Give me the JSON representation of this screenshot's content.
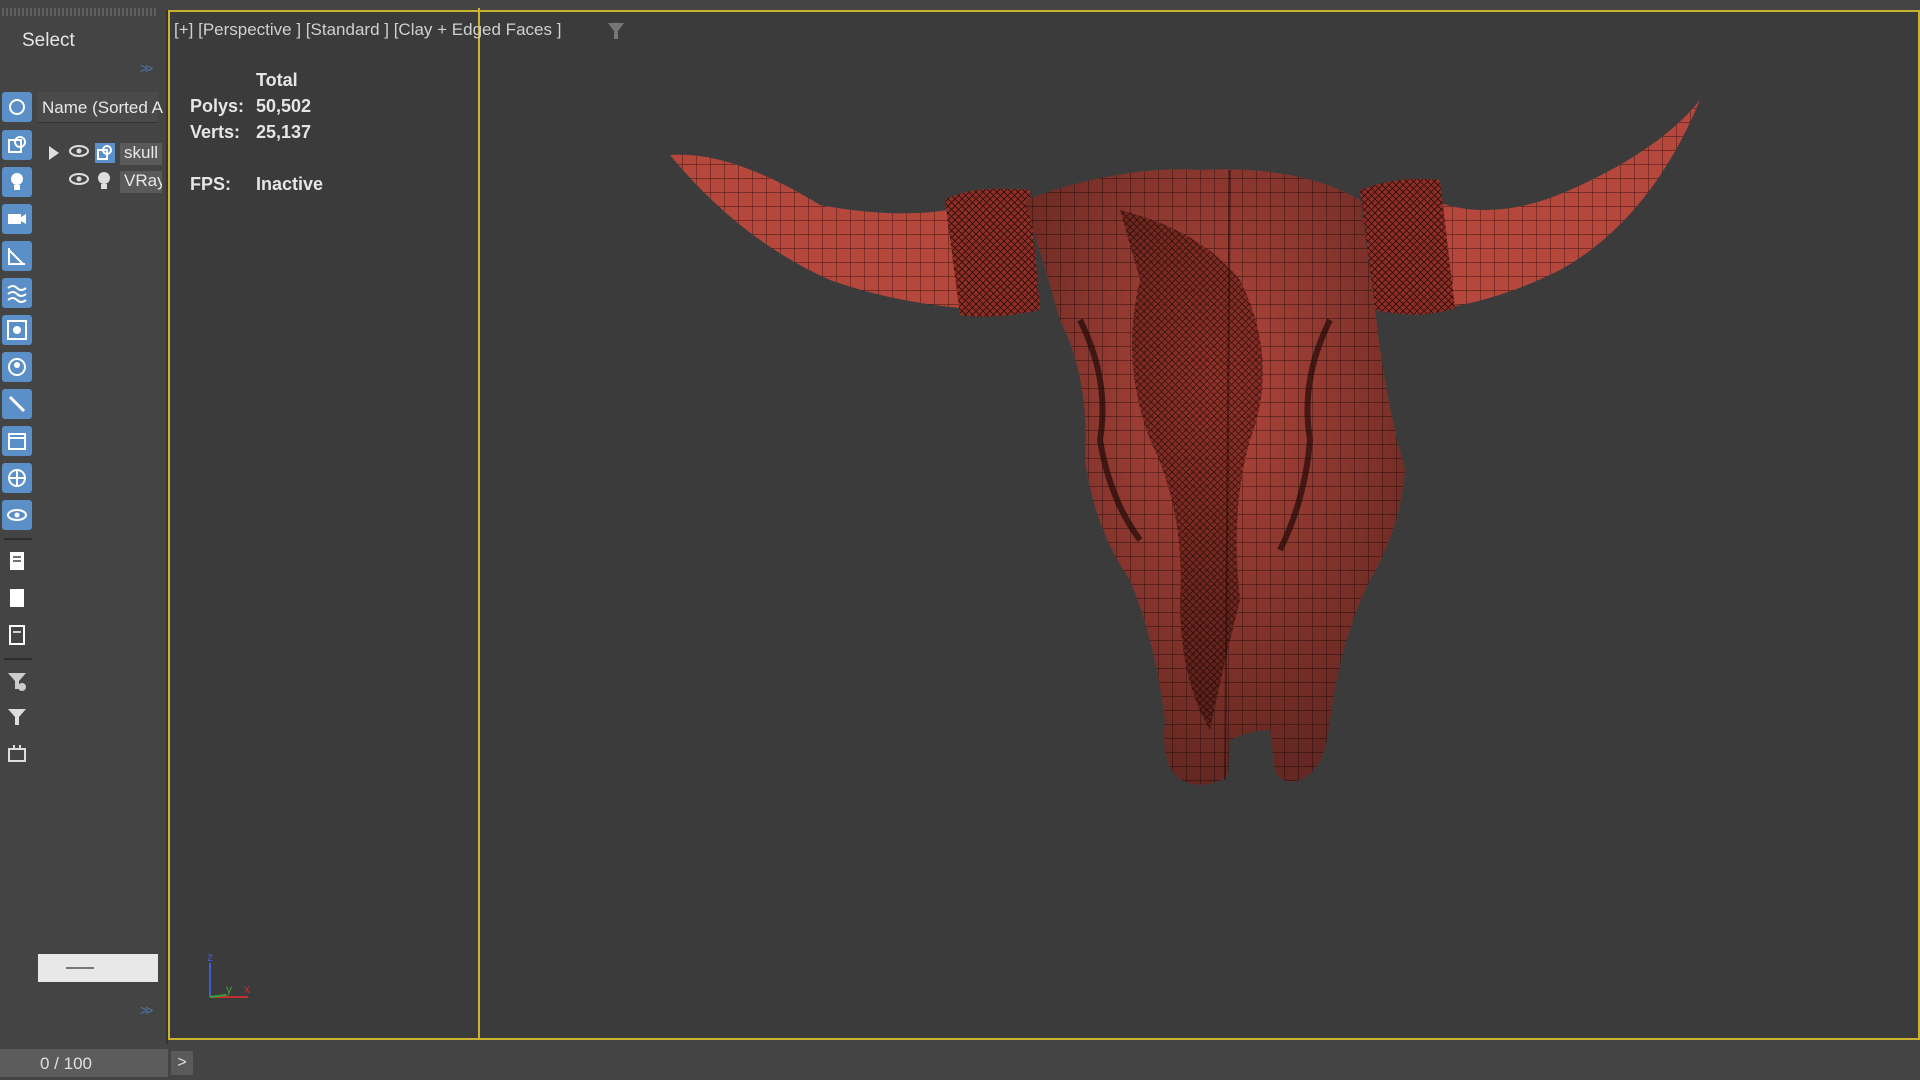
{
  "explorer": {
    "title": "Select",
    "column_header": "Name (Sorted A",
    "items": [
      {
        "label": "skull",
        "icon": "geometry-object-icon"
      },
      {
        "label": "VRay",
        "icon": "light-object-icon"
      }
    ]
  },
  "viewport": {
    "label": "[+] [Perspective ] [Standard ] [Clay + Edged Faces ]",
    "stats": {
      "header": "Total",
      "polys_label": "Polys:",
      "polys_value": "50,502",
      "verts_label": "Verts:",
      "verts_value": "25,137",
      "fps_label": "FPS:",
      "fps_value": "Inactive"
    },
    "axis": {
      "z": "z",
      "y": "y",
      "x": "x"
    },
    "active_border_color": "#c9b230",
    "model_color": "#b5473c"
  },
  "timeline": {
    "frame_display": "0 / 100",
    "next_label": ">"
  }
}
